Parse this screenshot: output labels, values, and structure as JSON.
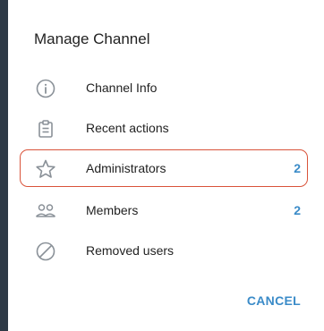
{
  "dialog": {
    "title": "Manage Channel",
    "items": [
      {
        "label": "Channel Info",
        "icon": "info-icon",
        "count": ""
      },
      {
        "label": "Recent actions",
        "icon": "clipboard-icon",
        "count": ""
      },
      {
        "label": "Administrators",
        "icon": "star-icon",
        "count": "2"
      },
      {
        "label": "Members",
        "icon": "members-icon",
        "count": "2"
      },
      {
        "label": "Removed users",
        "icon": "blocked-icon",
        "count": ""
      }
    ],
    "cancel_label": "CANCEL"
  },
  "colors": {
    "accent": "#3a8bc8",
    "highlight_border": "#d9533a",
    "icon": "#8a9198",
    "left_strip": "#2e3a46"
  }
}
